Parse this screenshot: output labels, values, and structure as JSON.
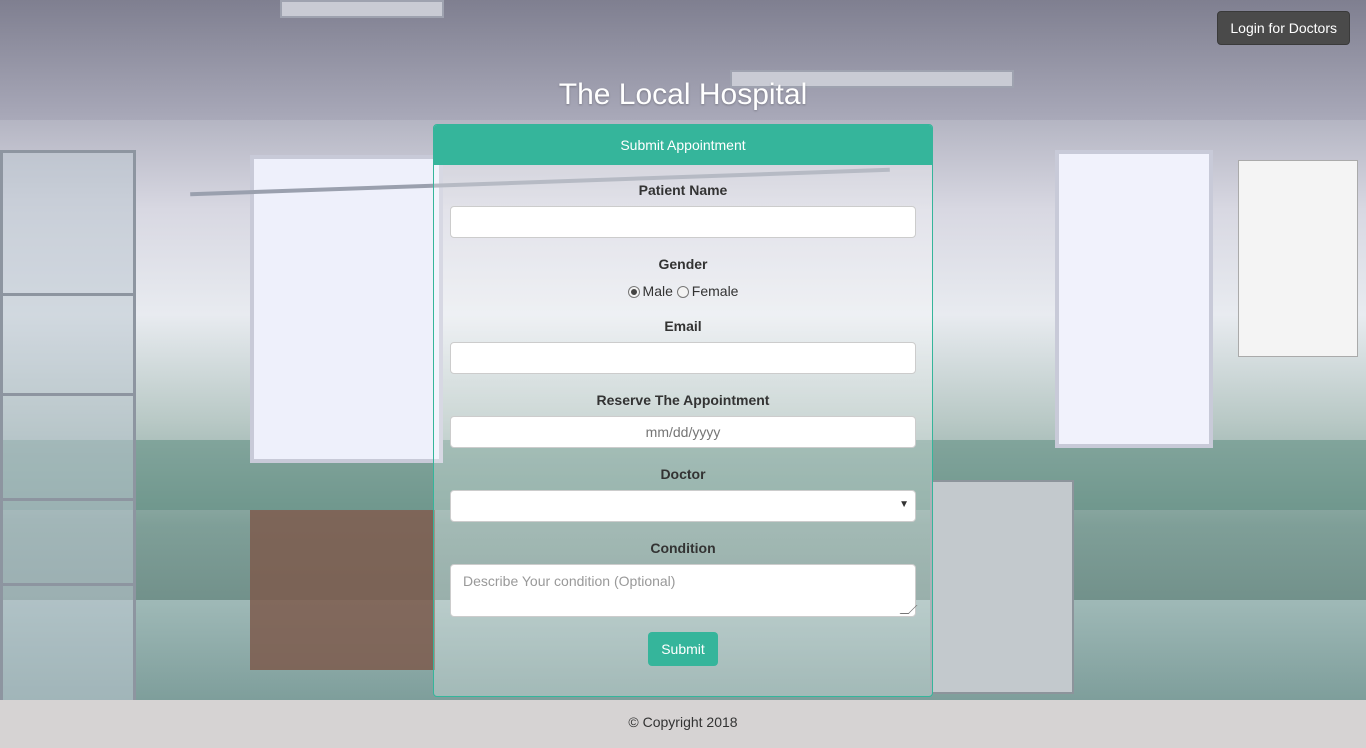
{
  "header": {
    "login_label": "Login for Doctors",
    "title": "The Local Hospital"
  },
  "form": {
    "panel_title": "Submit Appointment",
    "patient_name": {
      "label": "Patient Name",
      "value": ""
    },
    "gender": {
      "label": "Gender",
      "options": [
        {
          "label": "Male",
          "selected": true
        },
        {
          "label": "Female",
          "selected": false
        }
      ]
    },
    "email": {
      "label": "Email",
      "value": ""
    },
    "appointment": {
      "label": "Reserve The Appointment",
      "placeholder": "mm/dd/yyyy"
    },
    "doctor": {
      "label": "Doctor",
      "selected": ""
    },
    "condition": {
      "label": "Condition",
      "placeholder": "Describe Your condition (Optional)"
    },
    "submit_label": "Submit"
  },
  "footer": {
    "copyright": "© Copyright 2018"
  },
  "colors": {
    "accent": "#35b59b",
    "login_button": "#4a4a4a",
    "footer_bg": "#d6d3d3"
  }
}
